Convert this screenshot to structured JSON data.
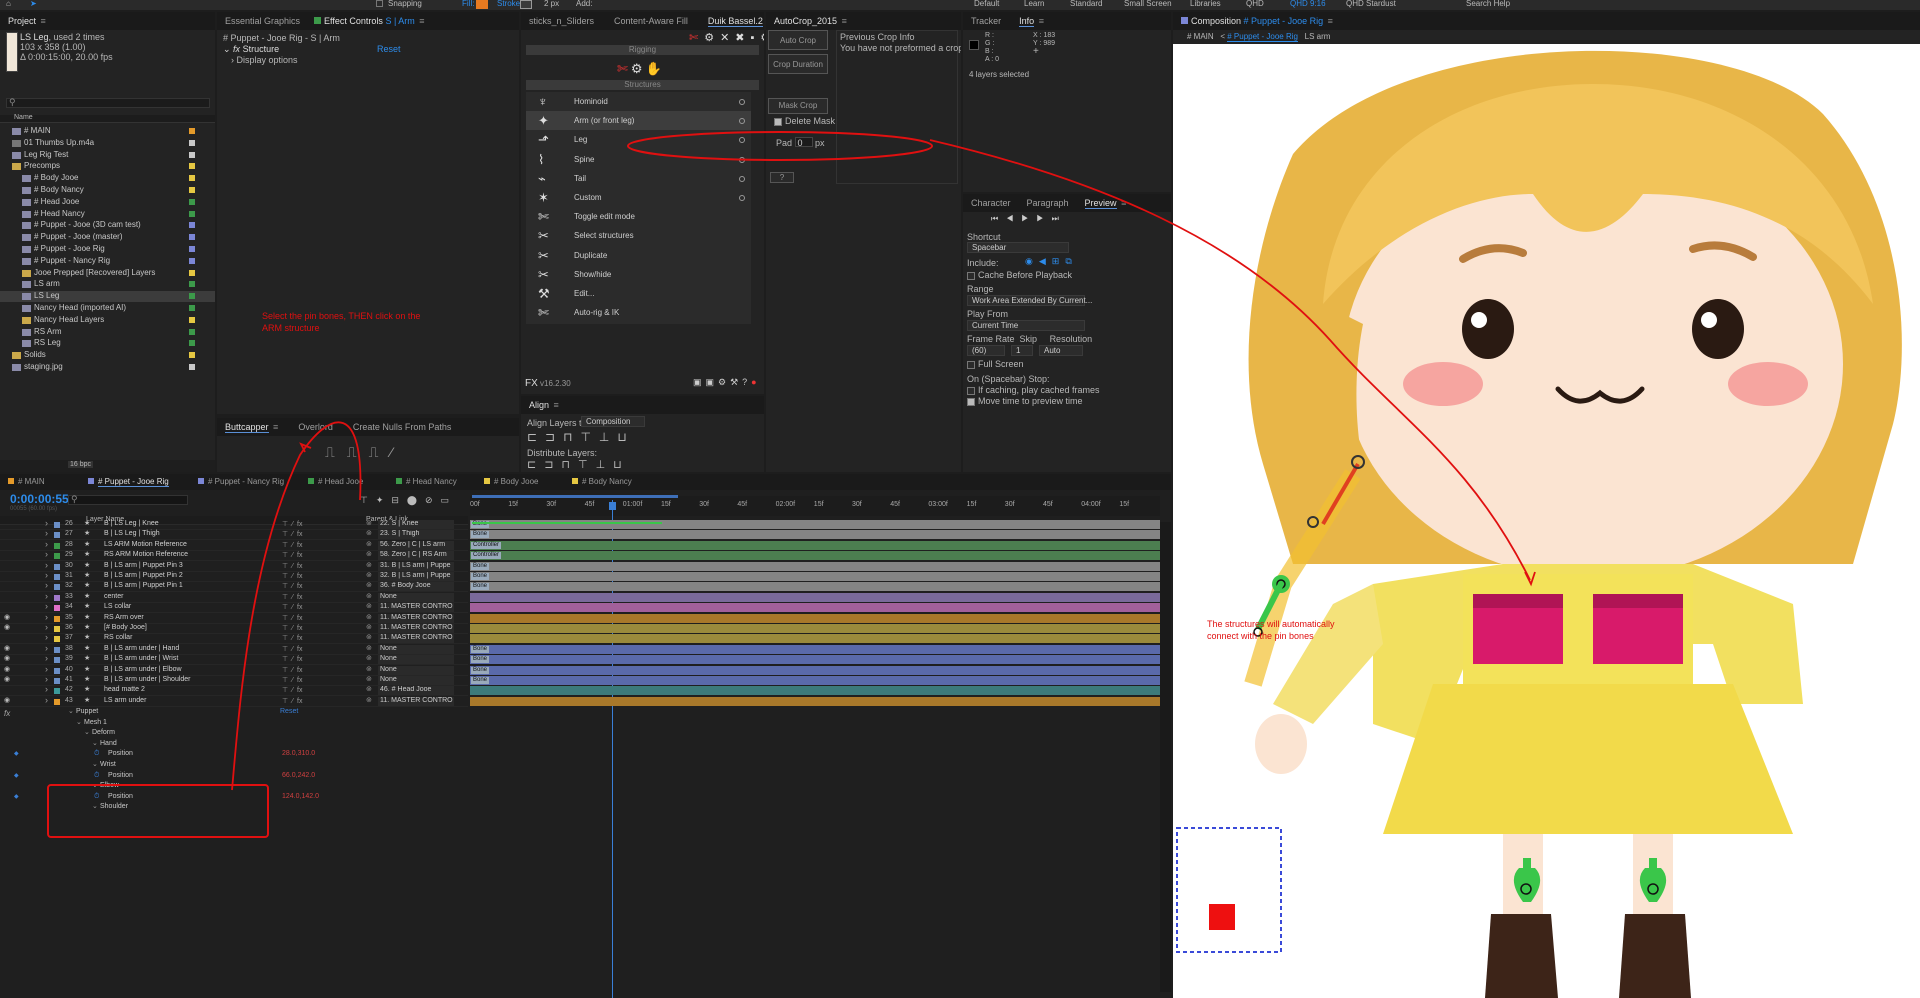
{
  "topbar": {
    "snapping": "Snapping",
    "fill": "Fill:",
    "stroke": "Stroke:",
    "stroke_px": "2 px",
    "add": "Add:",
    "workspaces": [
      "Default",
      "Learn",
      "Standard",
      "Small Screen",
      "Libraries",
      "QHD",
      "QHD 9:16",
      "QHD Stardust"
    ],
    "search": "Search Help"
  },
  "project": {
    "title": "Project",
    "item_name": "LS Leg",
    "item_used": ", used 2 times",
    "item_dims": "103 x 358 (1.00)",
    "item_duration": "Δ 0:00:15:00, 20.00 fps",
    "col_name": "Name",
    "items": [
      {
        "name": "# MAIN",
        "indent": 0,
        "color": "#e49a2a",
        "kind": "comp"
      },
      {
        "name": "01 Thumbs Up.m4a",
        "indent": 0,
        "color": "#c8c8c8",
        "kind": "audio"
      },
      {
        "name": "Leg Rig Test",
        "indent": 0,
        "color": "#c8c8c8",
        "kind": "comp"
      },
      {
        "name": "Precomps",
        "indent": 0,
        "color": "#e5c742",
        "kind": "folder"
      },
      {
        "name": "# Body Jooe",
        "indent": 1,
        "color": "#e5c742",
        "kind": "comp"
      },
      {
        "name": "# Body Nancy",
        "indent": 1,
        "color": "#e5c742",
        "kind": "comp"
      },
      {
        "name": "# Head Jooe",
        "indent": 1,
        "color": "#3c9a4a",
        "kind": "comp"
      },
      {
        "name": "# Head Nancy",
        "indent": 1,
        "color": "#3c9a4a",
        "kind": "comp"
      },
      {
        "name": "# Puppet - Jooe (3D cam test)",
        "indent": 1,
        "color": "#7b86d6",
        "kind": "comp"
      },
      {
        "name": "# Puppet - Jooe (master)",
        "indent": 1,
        "color": "#7b86d6",
        "kind": "comp"
      },
      {
        "name": "# Puppet - Jooe Rig",
        "indent": 1,
        "color": "#7b86d6",
        "kind": "comp"
      },
      {
        "name": "# Puppet - Nancy Rig",
        "indent": 1,
        "color": "#7b86d6",
        "kind": "comp"
      },
      {
        "name": "Jooe Prepped [Recovered] Layers",
        "indent": 1,
        "color": "#e5c742",
        "kind": "folder"
      },
      {
        "name": "LS arm",
        "indent": 1,
        "color": "#3c9a4a",
        "kind": "comp"
      },
      {
        "name": "LS Leg",
        "indent": 1,
        "color": "#3c9a4a",
        "kind": "comp",
        "selected": true
      },
      {
        "name": "Nancy Head (imported AI)",
        "indent": 1,
        "color": "#3c9a4a",
        "kind": "comp"
      },
      {
        "name": "Nancy Head Layers",
        "indent": 1,
        "color": "#e5c742",
        "kind": "folder"
      },
      {
        "name": "RS Arm",
        "indent": 1,
        "color": "#3c9a4a",
        "kind": "comp"
      },
      {
        "name": "RS Leg",
        "indent": 1,
        "color": "#3c9a4a",
        "kind": "comp"
      },
      {
        "name": "Solids",
        "indent": 0,
        "color": "#e5c742",
        "kind": "folder"
      },
      {
        "name": "staging.jpg",
        "indent": 0,
        "color": "#c8c8c8",
        "kind": "image"
      }
    ],
    "bpc": "16 bpc"
  },
  "effect_controls": {
    "tabs": [
      "Essential Graphics",
      "Effect Controls",
      "S | Arm"
    ],
    "comp_path": "# Puppet - Jooe Rig - S | Arm",
    "effect": "Structure",
    "reset": "Reset",
    "display_options": "Display options"
  },
  "annotations": {
    "instruction": "Select the pin bones, THEN click on the ARM structure",
    "connect": "The structures will automatically connect with the pin bones"
  },
  "duik": {
    "tabs": [
      "sticks_n_Sliders",
      "Content-Aware Fill",
      "Duik Bassel.2"
    ],
    "rigging": "Rigging",
    "structures": "Structures",
    "items": [
      "Hominoid",
      "Arm (or front leg)",
      "Leg",
      "Spine",
      "Tail",
      "Custom",
      "Toggle edit mode",
      "Select structures",
      "Duplicate",
      "Show/hide",
      "Edit...",
      "Auto-rig & IK"
    ],
    "version": "v16.2.30"
  },
  "autocrop": {
    "title": "AutoCrop_2015",
    "auto_crop": "Auto Crop",
    "crop_duration": "Crop Duration",
    "mask_crop": "Mask Crop",
    "delete_mask": "Delete Mask",
    "pad": "Pad",
    "pad_value": "0",
    "px": "px",
    "help": "?",
    "prev_title": "Previous Crop Info",
    "prev_text": "You have not preformed a crop"
  },
  "info": {
    "tabs": [
      "Tracker",
      "Info"
    ],
    "rgb": [
      "R :",
      "G :",
      "B :",
      "A : 0"
    ],
    "x": "X : 183",
    "y": "Y : 989",
    "layers": "4 layers selected"
  },
  "preview": {
    "tabs": [
      "Character",
      "Paragraph",
      "Preview"
    ],
    "shortcut": "Shortcut",
    "shortcut_val": "Spacebar",
    "include": "Include:",
    "cache": "Cache Before Playback",
    "range": "Range",
    "range_val": "Work Area Extended By Current...",
    "play_from": "Play From",
    "play_from_val": "Current Time",
    "frame_rate": "Frame Rate",
    "skip": "Skip",
    "resolution": "Resolution",
    "fr_val": "(60)",
    "skip_val": "1",
    "res_val": "Auto",
    "full_screen": "Full Screen",
    "on_stop": "On (Spacebar) Stop:",
    "if_caching": "If caching, play cached frames",
    "move_time": "Move time to preview time"
  },
  "bottom_left": {
    "tabs": [
      "Buttcapper",
      "Overlord",
      "Create Nulls From Paths"
    ]
  },
  "align": {
    "title": "Align",
    "align_to": "Align Layers to:",
    "align_to_val": "Composition",
    "distribute": "Distribute Layers:"
  },
  "composition": {
    "tab": "Composition",
    "name": "# Puppet - Jooe Rig",
    "crumbs": [
      "# MAIN",
      "# Puppet - Jooe Rig",
      "LS arm"
    ]
  },
  "timeline": {
    "tabs": [
      "# MAIN",
      "# Puppet - Jooe Rig",
      "# Puppet - Nancy Rig",
      "# Head Jooe",
      "# Head Nancy",
      "# Body Jooe",
      "# Body Nancy"
    ],
    "tab_colors": [
      "#e49a2a",
      "#7b86d6",
      "#7b86d6",
      "#3c9a4a",
      "#3c9a4a",
      "#e5c742",
      "#e5c742"
    ],
    "timecode": "0:00:00:55",
    "timecode_sub": "00055 (60.00 fps)",
    "col_layer": "Layer Name",
    "col_parent": "Parent & Link",
    "ruler": [
      "00f",
      "15f",
      "30f",
      "45f",
      "01:00f",
      "15f",
      "30f",
      "45f",
      "02:00f",
      "15f",
      "30f",
      "45f",
      "03:00f",
      "15f",
      "30f",
      "45f",
      "04:00f",
      "15f"
    ],
    "layers": [
      {
        "num": "26",
        "color": "#6b8fc7",
        "name": "B | LS Leg | Knee",
        "parent": "22. S | Knee",
        "bar": "#848484",
        "tag": "Bone",
        "eye": false
      },
      {
        "num": "27",
        "color": "#6b8fc7",
        "name": "B | LS Leg | Thigh",
        "parent": "23. S | Thigh",
        "bar": "#848484",
        "tag": "Bone",
        "eye": false
      },
      {
        "num": "28",
        "color": "#3c9a4a",
        "name": "LS ARM Motion Reference",
        "parent": "56. Zero | C | LS arm",
        "bar": "#4c7e50",
        "tag": "Controller",
        "eye": false
      },
      {
        "num": "29",
        "color": "#3c9a4a",
        "name": "RS ARM Motion Reference",
        "parent": "58. Zero | C | RS Arm",
        "bar": "#4c7e50",
        "tag": "Controller",
        "eye": false
      },
      {
        "num": "30",
        "color": "#6b8fc7",
        "name": "B | LS arm | Puppet Pin 3",
        "parent": "31. B | LS arm | Puppe",
        "bar": "#848484",
        "tag": "Bone",
        "eye": false
      },
      {
        "num": "31",
        "color": "#6b8fc7",
        "name": "B | LS arm | Puppet Pin 2",
        "parent": "32. B | LS arm | Puppe",
        "bar": "#848484",
        "tag": "Bone",
        "eye": false
      },
      {
        "num": "32",
        "color": "#6b8fc7",
        "name": "B | LS arm | Puppet Pin 1",
        "parent": "36. # Body Jooe",
        "bar": "#848484",
        "tag": "Bone",
        "eye": false
      },
      {
        "num": "33",
        "color": "#a078c8",
        "name": "center",
        "parent": "None",
        "bar": "#7a6a9a",
        "tag": "",
        "eye": false
      },
      {
        "num": "34",
        "color": "#e070c8",
        "name": "LS collar",
        "parent": "11. MASTER CONTRO",
        "bar": "#a2609a",
        "tag": "",
        "eye": false
      },
      {
        "num": "35",
        "color": "#e49a2a",
        "name": "RS Arm over",
        "parent": "11. MASTER CONTRO",
        "bar": "#a8782a",
        "tag": "",
        "eye": true
      },
      {
        "num": "36",
        "color": "#e5c742",
        "name": "[# Body Jooe]",
        "parent": "11. MASTER CONTRO",
        "bar": "#9a8a3c",
        "tag": "",
        "eye": true
      },
      {
        "num": "37",
        "color": "#e5c742",
        "name": "RS collar",
        "parent": "11. MASTER CONTRO",
        "bar": "#9a8a3c",
        "tag": "",
        "eye": false
      },
      {
        "num": "38",
        "color": "#6b8fc7",
        "name": "B | LS arm under | Hand",
        "parent": "None",
        "bar": "#5a6aaa",
        "tag": "Bone",
        "eye": true
      },
      {
        "num": "39",
        "color": "#6b8fc7",
        "name": "B | LS arm under | Wrist",
        "parent": "None",
        "bar": "#5a6aaa",
        "tag": "Bone",
        "eye": true
      },
      {
        "num": "40",
        "color": "#6b8fc7",
        "name": "B | LS arm under | Elbow",
        "parent": "None",
        "bar": "#5a6aaa",
        "tag": "Bone",
        "eye": true
      },
      {
        "num": "41",
        "color": "#6b8fc7",
        "name": "B | LS arm under | Shoulder",
        "parent": "None",
        "bar": "#5a6aaa",
        "tag": "Bone",
        "eye": true
      },
      {
        "num": "42",
        "color": "#3c9a9a",
        "name": "head matte 2",
        "parent": "46. # Head Jooe",
        "bar": "#3c7a7a",
        "tag": "",
        "eye": false
      },
      {
        "num": "43",
        "color": "#e49a2a",
        "name": "LS arm under",
        "parent": "11. MASTER CONTRO",
        "bar": "#a8782a",
        "tag": "",
        "eye": true
      }
    ],
    "props": [
      {
        "indent": 1,
        "name": "Puppet",
        "value": "Reset",
        "valcolor": "#3a7fd6"
      },
      {
        "indent": 2,
        "name": "Mesh 1",
        "value": "",
        "valcolor": ""
      },
      {
        "indent": 3,
        "name": "Deform",
        "value": "",
        "valcolor": ""
      },
      {
        "indent": 4,
        "name": "Hand",
        "value": "",
        "valcolor": ""
      },
      {
        "indent": 5,
        "name": "Position",
        "value": "28.0,310.0",
        "valcolor": "#d04040",
        "key": true
      },
      {
        "indent": 4,
        "name": "Wrist",
        "value": "",
        "valcolor": ""
      },
      {
        "indent": 5,
        "name": "Position",
        "value": "66.0,242.0",
        "valcolor": "#d04040",
        "key": true
      },
      {
        "indent": 4,
        "name": "Elbow",
        "value": "",
        "valcolor": ""
      },
      {
        "indent": 5,
        "name": "Position",
        "value": "124.0,142.0",
        "valcolor": "#d04040",
        "key": true
      },
      {
        "indent": 4,
        "name": "Shoulder",
        "value": "",
        "valcolor": ""
      }
    ]
  },
  "colors": {
    "accent": "#2d8ceb",
    "annotation": "#e01010",
    "panel": "#232323"
  }
}
